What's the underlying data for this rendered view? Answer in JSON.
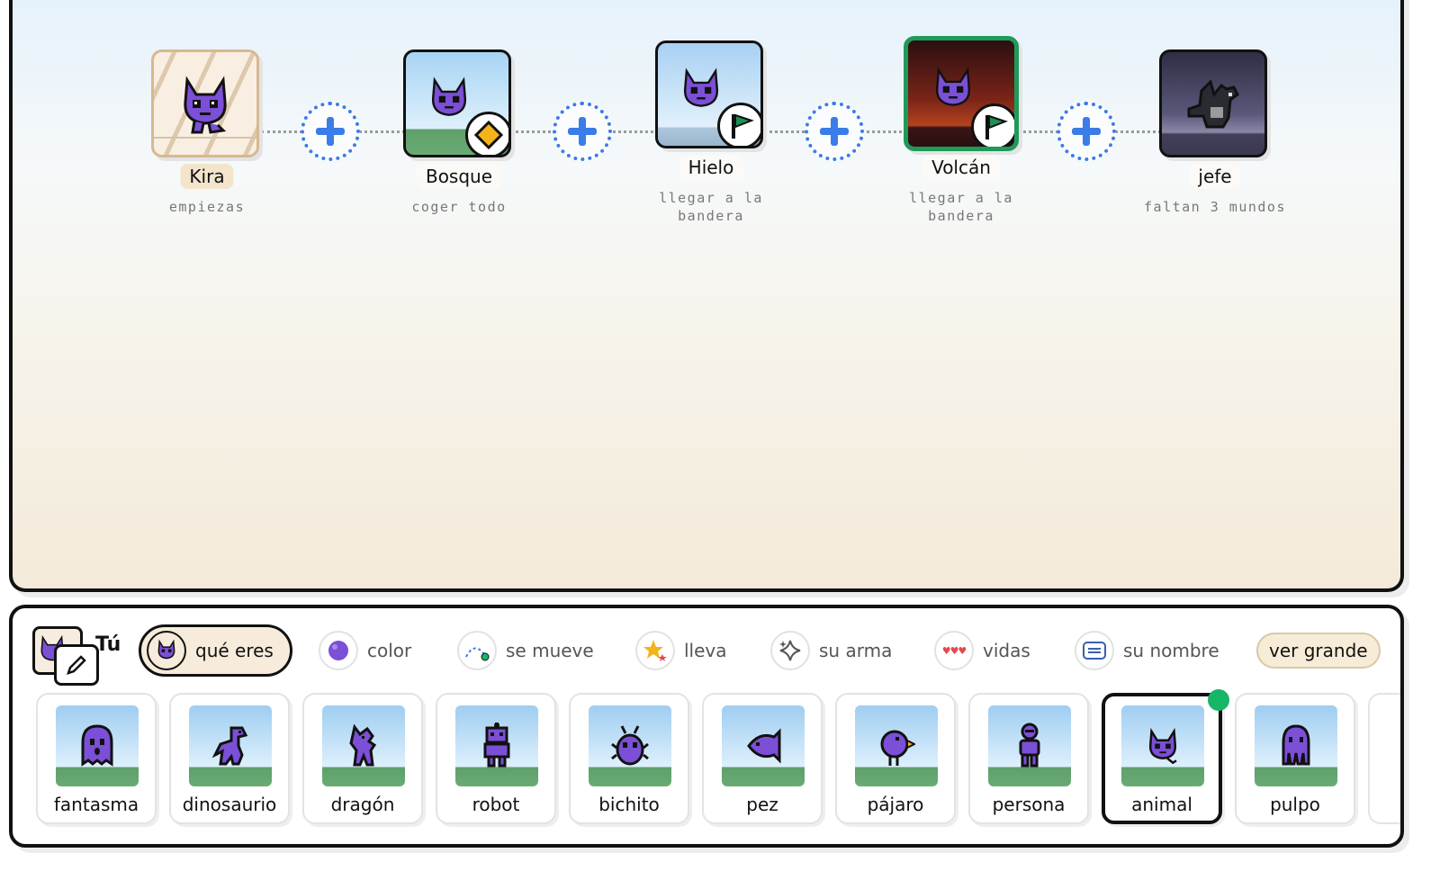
{
  "path": {
    "nodes": [
      {
        "label": "Kira",
        "sublabel": "empiezas"
      },
      {
        "label": "Bosque",
        "sublabel": "coger todo",
        "badge": "diamond-goal-icon"
      },
      {
        "label": "Hielo",
        "sublabel": "llegar a la bandera",
        "badge": "flag-goal-icon"
      },
      {
        "label": "Volcán",
        "sublabel": "llegar a la bandera",
        "badge": "flag-goal-icon",
        "selected": true
      },
      {
        "label": "jefe",
        "sublabel": "faltan 3 mundos"
      }
    ],
    "add_icon": "plus-icon"
  },
  "toolbar": {
    "you_label": "Tú",
    "tabs": [
      {
        "label": "qué eres",
        "icon": "character-icon",
        "active": true
      },
      {
        "label": "color",
        "icon": "color-dot-icon"
      },
      {
        "label": "se mueve",
        "icon": "motion-path-icon"
      },
      {
        "label": "lleva",
        "icon": "star-icon"
      },
      {
        "label": "su arma",
        "icon": "sparkle-icon"
      },
      {
        "label": "vidas",
        "icon": "hearts-icon"
      },
      {
        "label": "su nombre",
        "icon": "name-tag-icon"
      }
    ],
    "view_large": "ver grande"
  },
  "characters": [
    {
      "label": "fantasma"
    },
    {
      "label": "dinosaurio"
    },
    {
      "label": "dragón"
    },
    {
      "label": "robot"
    },
    {
      "label": "bichito"
    },
    {
      "label": "pez"
    },
    {
      "label": "pájaro"
    },
    {
      "label": "persona"
    },
    {
      "label": "animal",
      "selected": true
    },
    {
      "label": "pulpo"
    }
  ],
  "colors": {
    "accent_blue": "#3a7ce8",
    "selected_green": "#17b566",
    "sprite_purple": "#7b4fd6",
    "outline": "#111111"
  }
}
